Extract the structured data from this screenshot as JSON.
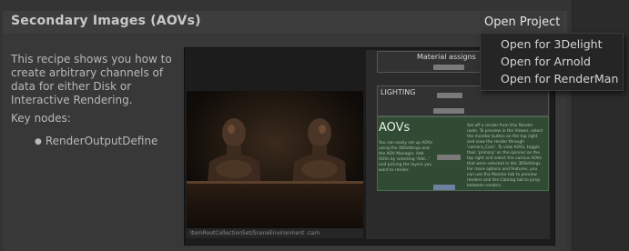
{
  "header": {
    "title": "Secondary Images (AOVs)"
  },
  "open_project": {
    "label": "Open Project",
    "options": [
      "Open for 3Delight",
      "Open for Arnold",
      "Open for RenderMan"
    ]
  },
  "description": "This recipe shows you how to create arbitrary channels of data for either Disk or Interactive Rendering.",
  "key_nodes": {
    "label": "Key nodes:",
    "items": [
      "RenderOutputDefine"
    ]
  },
  "screenshot": {
    "graph_material_label": "Material assigns",
    "graph_lighting_label": "LIGHTING",
    "graph_aovs_title": "AOVs",
    "graph_aovs_text_left": "You can easily set up AOVs using the 3DSettings and the AOV Manager. Add AOVs by selecting 'Add...' and picking the layers you want to render.",
    "graph_aovs_text_right": "Set off a render from this Render node. To preview in the Viewer, select the monitor button on the top right and view the render through 'camera_Cam'. To view AOVs, toggle their 'primary' on the spinner on the top right and select the various AOVs that were selected in the 3DSettings. For more options and features, you can use the Monitor tab to preview renders and the Catalog tab to jump between renders.",
    "viewer_status": "ItemRootCollectionSet/SceneEnvironment  .cam"
  }
}
